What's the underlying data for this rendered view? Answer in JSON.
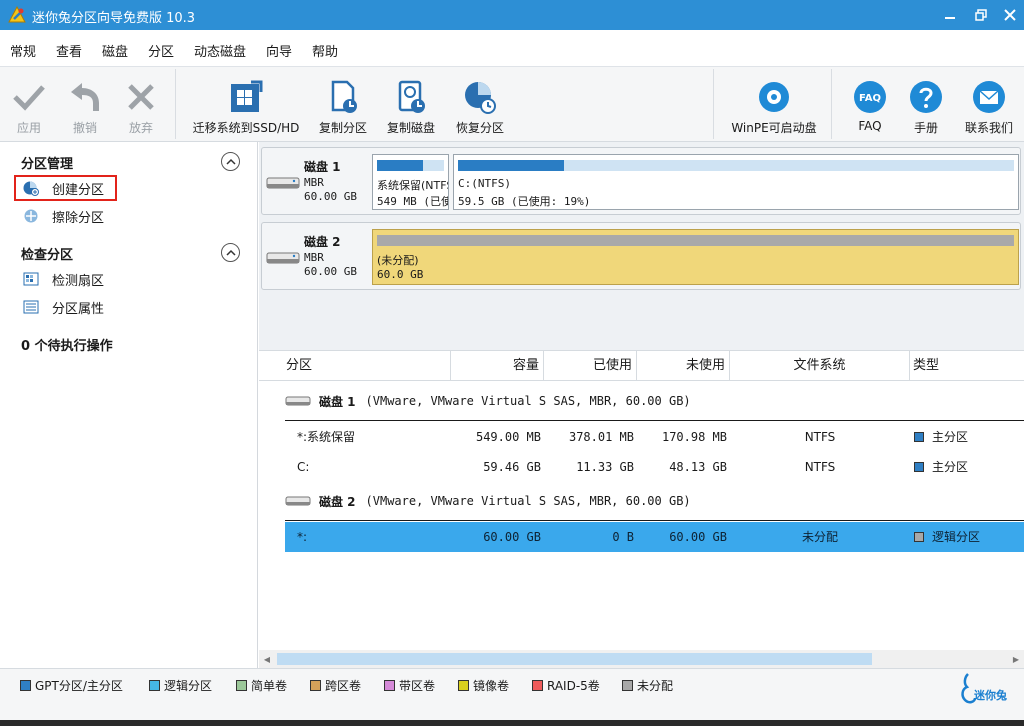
{
  "window": {
    "title": "迷你兔分区向导免费版 10.3"
  },
  "menu": [
    "常规",
    "查看",
    "磁盘",
    "分区",
    "动态磁盘",
    "向导",
    "帮助"
  ],
  "toolbar": {
    "apply": "应用",
    "undo": "撤销",
    "discard": "放弃",
    "migrate": "迁移系统到SSD/HD",
    "copy_partition": "复制分区",
    "copy_disk": "复制磁盘",
    "recover_partition": "恢复分区",
    "winpe": "WinPE可启动盘",
    "faq": "FAQ",
    "manual": "手册",
    "contact": "联系我们",
    "faq_icon_text": "FAQ"
  },
  "sidebar": {
    "group1": "分区管理",
    "create_partition": "创建分区",
    "wipe_partition": "擦除分区",
    "group2": "检查分区",
    "surface_test": "检测扇区",
    "partition_properties": "分区属性",
    "pending": "0 个待执行操作"
  },
  "diskmap": {
    "disk1": {
      "name": "磁盘 1",
      "scheme": "MBR",
      "size": "60.00 GB",
      "p1": {
        "line1": "系统保留(NTFS)",
        "line2": "549 MB (已使用: 68%)",
        "used_fraction": 0.68
      },
      "p2": {
        "line1": "C:(NTFS)",
        "line2": "59.5 GB (已使用: 19%)",
        "used_fraction": 0.19
      }
    },
    "disk2": {
      "name": "磁盘 2",
      "scheme": "MBR",
      "size": "60.00 GB",
      "p1": {
        "line1": "(未分配)",
        "line2": "60.0 GB"
      }
    }
  },
  "table": {
    "headers": {
      "partition": "分区",
      "capacity": "容量",
      "used": "已使用",
      "unused": "未使用",
      "fs": "文件系统",
      "type": "类型"
    },
    "disk1": {
      "name": "磁盘 1",
      "desc": "(VMware, VMware Virtual S SAS, MBR, 60.00 GB)"
    },
    "disk2": {
      "name": "磁盘 2",
      "desc": "(VMware, VMware Virtual S SAS, MBR, 60.00 GB)"
    },
    "rows": [
      {
        "partition": "*:系统保留",
        "capacity": "549.00 MB",
        "used": "378.01 MB",
        "unused": "170.98 MB",
        "fs": "NTFS",
        "type": "主分区",
        "color": "#2f7fc4"
      },
      {
        "partition": "C:",
        "capacity": "59.46 GB",
        "used": "11.33 GB",
        "unused": "48.13 GB",
        "fs": "NTFS",
        "type": "主分区",
        "color": "#2f7fc4"
      },
      {
        "partition": "*:",
        "capacity": "60.00 GB",
        "used": "0 B",
        "unused": "60.00 GB",
        "fs": "未分配",
        "type": "逻辑分区",
        "color": "#a8a8a8"
      }
    ]
  },
  "legend": [
    {
      "label": "GPT分区/主分区",
      "color": "#2f7fc4"
    },
    {
      "label": "逻辑分区",
      "color": "#45b7e6"
    },
    {
      "label": "简单卷",
      "color": "#9cc89a"
    },
    {
      "label": "跨区卷",
      "color": "#d6a25a"
    },
    {
      "label": "带区卷",
      "color": "#d58ad8"
    },
    {
      "label": "镜像卷",
      "color": "#d8cf1e"
    },
    {
      "label": "RAID-5卷",
      "color": "#ee5b5b"
    },
    {
      "label": "未分配",
      "color": "#a8a8a8"
    }
  ],
  "brand": "迷你兔"
}
